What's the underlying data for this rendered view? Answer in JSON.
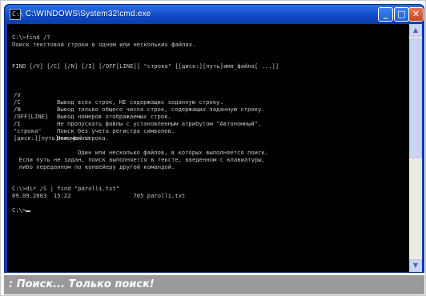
{
  "window": {
    "title": "C:\\WINDOWS\\System32\\cmd.exe",
    "minimize_glyph": "_",
    "maximize_glyph": "□",
    "close_glyph": "✕",
    "icon": "console-icon",
    "icon_text": "C:\\"
  },
  "console": {
    "lines": [
      "C:\\>find /?",
      "Поиск текстовой строки в одном или нескольких файлах.",
      "",
      "FIND [/V] [/C] [/N] [/I] [/OFF[LINE]] \"строка\" [[диск:][путь]имя_файла[ ...]]",
      "",
      "",
      "",
      "",
      "",
      "",
      "",
      "",
      "",
      "  Если путь не задан, поиск выполняется в тексте, введенном с клавиатуры,",
      "  либо переданном по конвейеру другой командой.",
      "",
      "C:\\>dir /S | find \"parolli.txt\"",
      "09.09.2003  15:22                  705 parolli.txt",
      "",
      "C:\\>"
    ],
    "options": [
      {
        "key": "/V",
        "desc": "Вывод всех строк, НЕ содержащих заданную строку."
      },
      {
        "key": "/C",
        "desc": "Вывод только общего числа строк, содержащих заданную строку."
      },
      {
        "key": "/N",
        "desc": "Вывод номеров отображаемых строк."
      },
      {
        "key": "/OFF[LINE]",
        "desc": "Не пропускать файлы с установленным атрибутом \"Автономный\"."
      },
      {
        "key": "/I",
        "desc": "Поиск без учета регистра символов."
      },
      {
        "key": "\"строка\"",
        "desc": "Искомая строка."
      },
      {
        "key": "[диск:][путь]имя_файла",
        "desc": ""
      },
      {
        "key": "",
        "desc": "      Один или несколько файлов, в которых выполняется поиск."
      }
    ]
  },
  "caption": {
    "text": ": Поиск... Только поиск!"
  },
  "colors": {
    "titlebar": "#1a57d0",
    "console_bg": "#000000",
    "console_text": "#c4c4c4",
    "caption_bg": "#9a9a9a"
  }
}
